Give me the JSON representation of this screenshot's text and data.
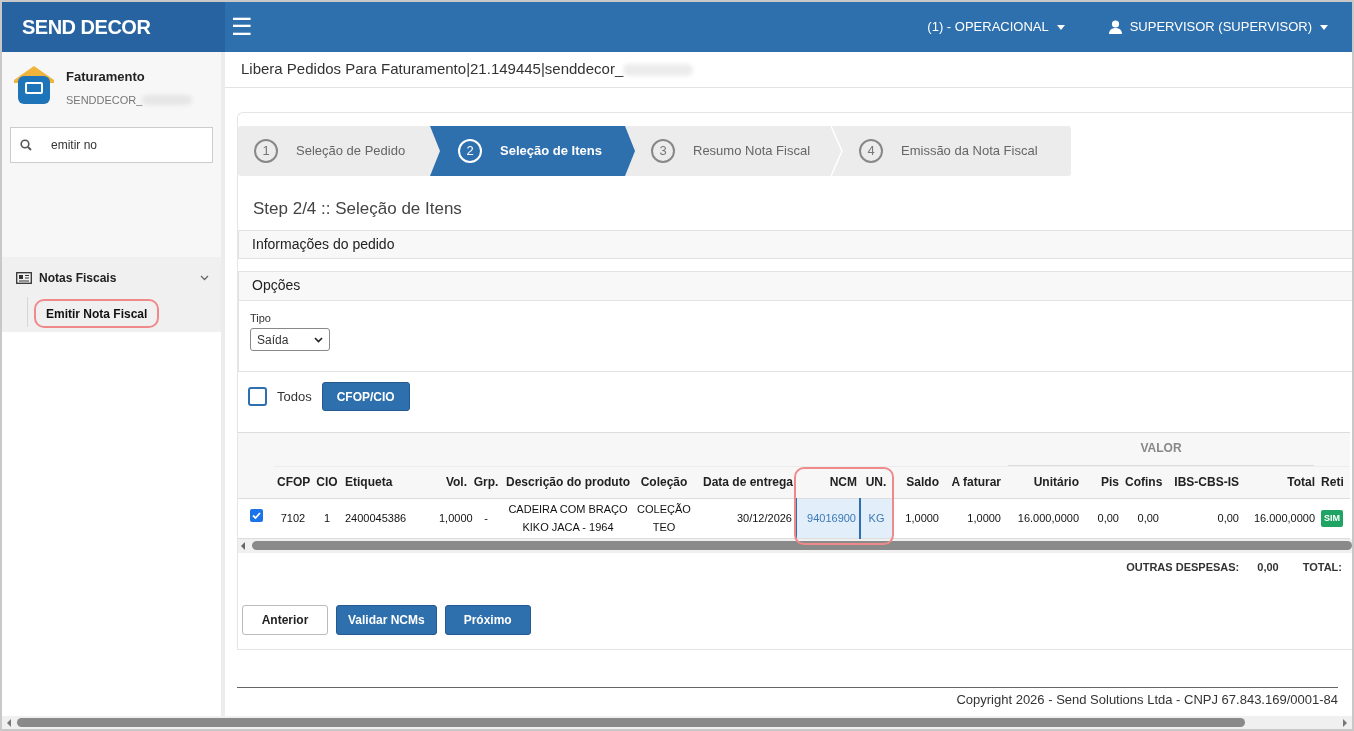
{
  "header": {
    "brand": "SEND DECOR",
    "menu_icon": "☰",
    "context_menu": "(1) - OPERACIONAL",
    "user_menu": "SUPERVISOR (SUPERVISOR)"
  },
  "sidebar": {
    "module": "Faturamento",
    "company": "SENDDECOR_",
    "search": {
      "value": "emitir no"
    },
    "groups": [
      {
        "label": "Notas Fiscais",
        "expanded": true,
        "children": [
          {
            "label": "Emitir Nota Fiscal",
            "highlighted": true
          }
        ]
      }
    ]
  },
  "breadcrumb": "Libera Pedidos Para Faturamento|21.149445|senddecor_",
  "steps": [
    {
      "number": "1",
      "label": "Seleção de Pedido",
      "selected": false
    },
    {
      "number": "2",
      "label": "Seleção de Itens",
      "selected": true
    },
    {
      "number": "3",
      "label": "Resumo Nota Fiscal",
      "selected": false
    },
    {
      "number": "4",
      "label": "Emissão da Nota Fiscal",
      "selected": false
    }
  ],
  "step_title": "Step 2/4 :: Seleção de Itens",
  "panels": [
    "Informações do pedido",
    "Opções"
  ],
  "tipo": {
    "label": "Tipo",
    "value": "Saída"
  },
  "select_all": {
    "label": "Todos",
    "checked": false
  },
  "cfop_button": "CFOP/CIO",
  "table": {
    "columns": [
      {
        "label": "CFOP"
      },
      {
        "label": "CIO"
      },
      {
        "label": "Etiqueta"
      },
      {
        "label": "Vol."
      },
      {
        "label": "Grp."
      },
      {
        "label": "Descrição do produto"
      },
      {
        "label": "Coleção"
      },
      {
        "label": "Data de entrega"
      },
      {
        "label": "NCM",
        "highlighted": true
      },
      {
        "label": "UN.",
        "highlighted": true
      },
      {
        "label": "Saldo"
      },
      {
        "label": "A faturar"
      },
      {
        "label": "VALOR",
        "colspan": 5,
        "children": [
          {
            "label": "Unitário"
          },
          {
            "label": "Pis"
          },
          {
            "label": "Cofins"
          },
          {
            "label": "IBS-CBS-IS"
          },
          {
            "label": "Total"
          }
        ]
      },
      {
        "label": "Reti"
      }
    ],
    "rows": [
      {
        "checked": true,
        "cells": [
          "7102",
          "1",
          "2400045386",
          "1,0000",
          "-",
          "CADEIRA COM BRAÇO KIKO JACA - 1964",
          "COLEÇÃO TEO",
          "30/12/2026",
          "94016900",
          "KG",
          "1,0000",
          "1,0000",
          "16.000,0000",
          "0,00",
          "0,00",
          "0,00",
          "16.000,0000",
          "SIM"
        ]
      }
    ]
  },
  "totals": [
    {
      "label": "OUTRAS DESPESAS:",
      "value": "0,00"
    },
    {
      "label": "TOTAL:"
    }
  ],
  "buttons": [
    {
      "label": "Anterior",
      "kind": "secondary"
    },
    {
      "label": "Validar NCMs",
      "kind": "primary"
    },
    {
      "label": "Próximo",
      "kind": "primary"
    }
  ],
  "footer": "Copyright 2026 - Send Solutions Ltda - CNPJ 67.843.169/0001-84"
}
